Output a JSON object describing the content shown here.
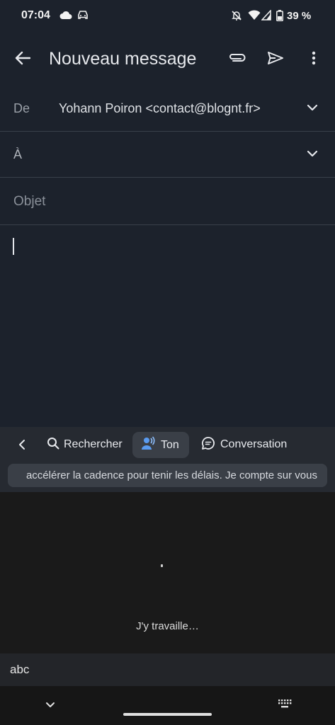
{
  "status_bar": {
    "time": "07:04",
    "battery": "39 %",
    "icons": [
      "cloud-icon",
      "car-icon",
      "notifications-off-icon",
      "wifi-icon",
      "signal-icon",
      "battery-icon"
    ]
  },
  "app_bar": {
    "title": "Nouveau message",
    "icons": [
      "back-arrow-icon",
      "paperclip-icon",
      "send-icon",
      "more-vert-icon"
    ]
  },
  "compose": {
    "from_label": "De",
    "from_value": "Yohann Poiron  <contact@blognt.fr>",
    "to_label": "À",
    "subject_placeholder": "Objet",
    "body": ""
  },
  "keyboard_strip": {
    "search_label": "Rechercher",
    "tone_label": "Ton",
    "conversation_label": "Conversation",
    "preview_text": "accélérer la cadence pour tenir les délais. Je compte sur vous"
  },
  "loading": {
    "text": "J'y travaille…"
  },
  "keyboard": {
    "abc_label": "abc"
  },
  "colors": {
    "background": "#1c222c",
    "strip": "#262a31",
    "chip": "#3a3f47",
    "tone_icon": "#5a9bf0"
  }
}
